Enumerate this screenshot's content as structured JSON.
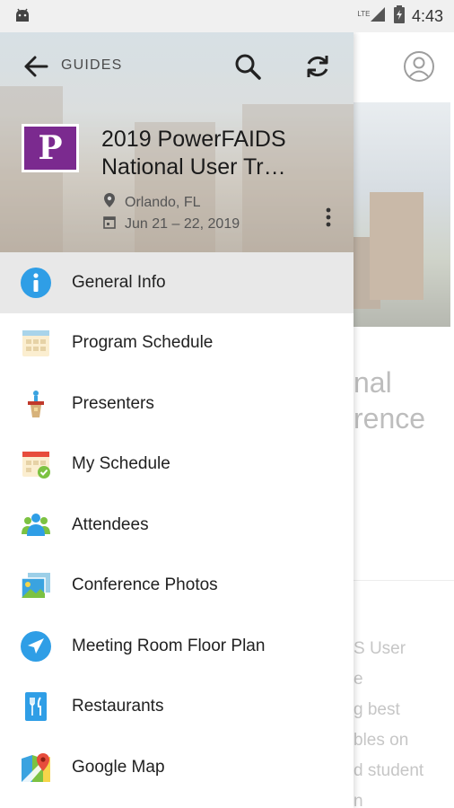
{
  "status_bar": {
    "time": "4:43",
    "network": "LTE",
    "icons": [
      "android-icon",
      "signal-icon",
      "battery-icon"
    ]
  },
  "toolbar": {
    "title": "GUIDES",
    "icons": [
      "back-arrow-icon",
      "search-icon",
      "refresh-icon"
    ]
  },
  "event": {
    "logo_letter": "P",
    "title_line1": "2019 PowerFAIDS",
    "title_line2": "National User Tr…",
    "location": "Orlando, FL",
    "dates": "Jun 21 – 22, 2019"
  },
  "menu": [
    {
      "label": "General Info",
      "icon": "info-icon",
      "active": true
    },
    {
      "label": "Program Schedule",
      "icon": "calendar-grid-icon",
      "active": false
    },
    {
      "label": "Presenters",
      "icon": "podium-icon",
      "active": false
    },
    {
      "label": "My Schedule",
      "icon": "calendar-check-icon",
      "active": false
    },
    {
      "label": "Attendees",
      "icon": "people-icon",
      "active": false
    },
    {
      "label": "Conference Photos",
      "icon": "photos-icon",
      "active": false
    },
    {
      "label": "Meeting Room Floor Plan",
      "icon": "navigation-arrow-icon",
      "active": false
    },
    {
      "label": "Restaurants",
      "icon": "fork-knife-icon",
      "active": false
    },
    {
      "label": "Google Map",
      "icon": "map-pin-icon",
      "active": false
    }
  ],
  "background_page": {
    "title_line1": "nal",
    "title_line2": "rence",
    "para_lines": [
      "S User",
      "e",
      "g best",
      "bles on",
      "d student",
      "n"
    ]
  },
  "colors": {
    "accent_blue": "#2f9ee6",
    "logo_purple": "#7b2a8f",
    "active_row": "#e8e8e8"
  }
}
